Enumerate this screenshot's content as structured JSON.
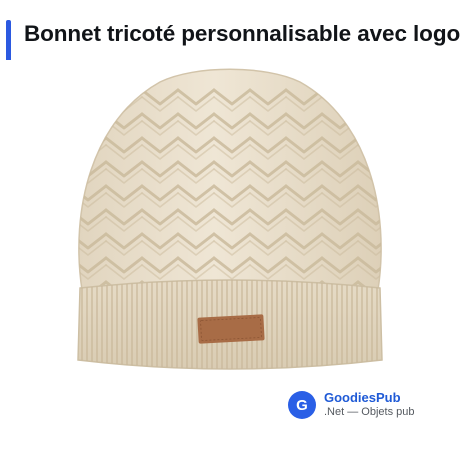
{
  "header": {
    "title": "Bonnet tricoté personnalisable avec logo",
    "accent_color": "#2b59e0"
  },
  "product": {
    "image_description": "cream cable-knit beanie with brown leather patch",
    "knit_color": "#ece2cf",
    "patch_color": "#a86c46"
  },
  "brand": {
    "logo_letter": "G",
    "name": "GoodiesPub",
    "tagline": ".Net — Objets pub",
    "color": "#2a5fe6"
  }
}
